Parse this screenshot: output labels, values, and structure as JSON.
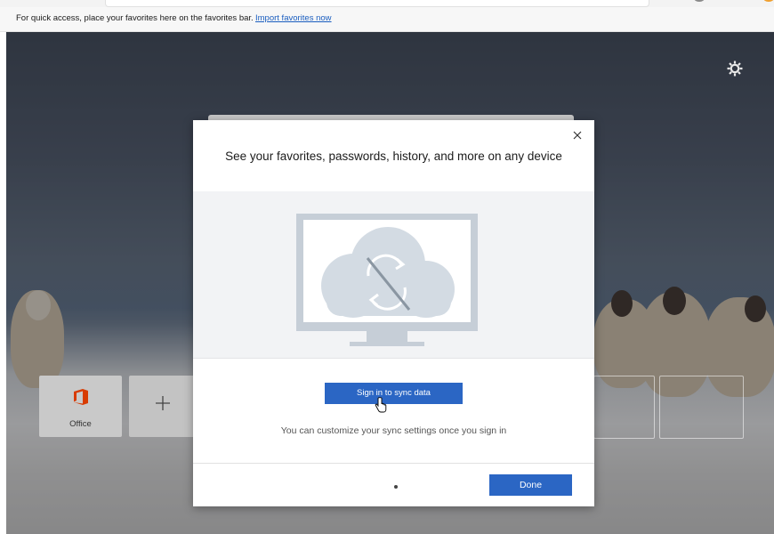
{
  "favorites_bar": {
    "message": "For quick access, place your favorites here on the favorites bar.",
    "import_link": "Import favorites now"
  },
  "new_tab": {
    "settings_icon": "gear-icon",
    "tiles": [
      {
        "label": "Office",
        "icon": "office-logo-icon"
      },
      {
        "label": "",
        "icon": "plus-icon"
      }
    ]
  },
  "sync_dialog": {
    "title": "See your favorites, passwords, history, and more on any device",
    "illustration": "sync-off-monitor-cloud-icon",
    "sign_in_button": "Sign in to sync data",
    "hint": "You can customize your sync settings once you sign in",
    "done_button": "Done",
    "close_icon": "close-icon"
  },
  "colors": {
    "accent": "#2b66c4",
    "office_red": "#d83b01",
    "link": "#1a5dbf"
  }
}
